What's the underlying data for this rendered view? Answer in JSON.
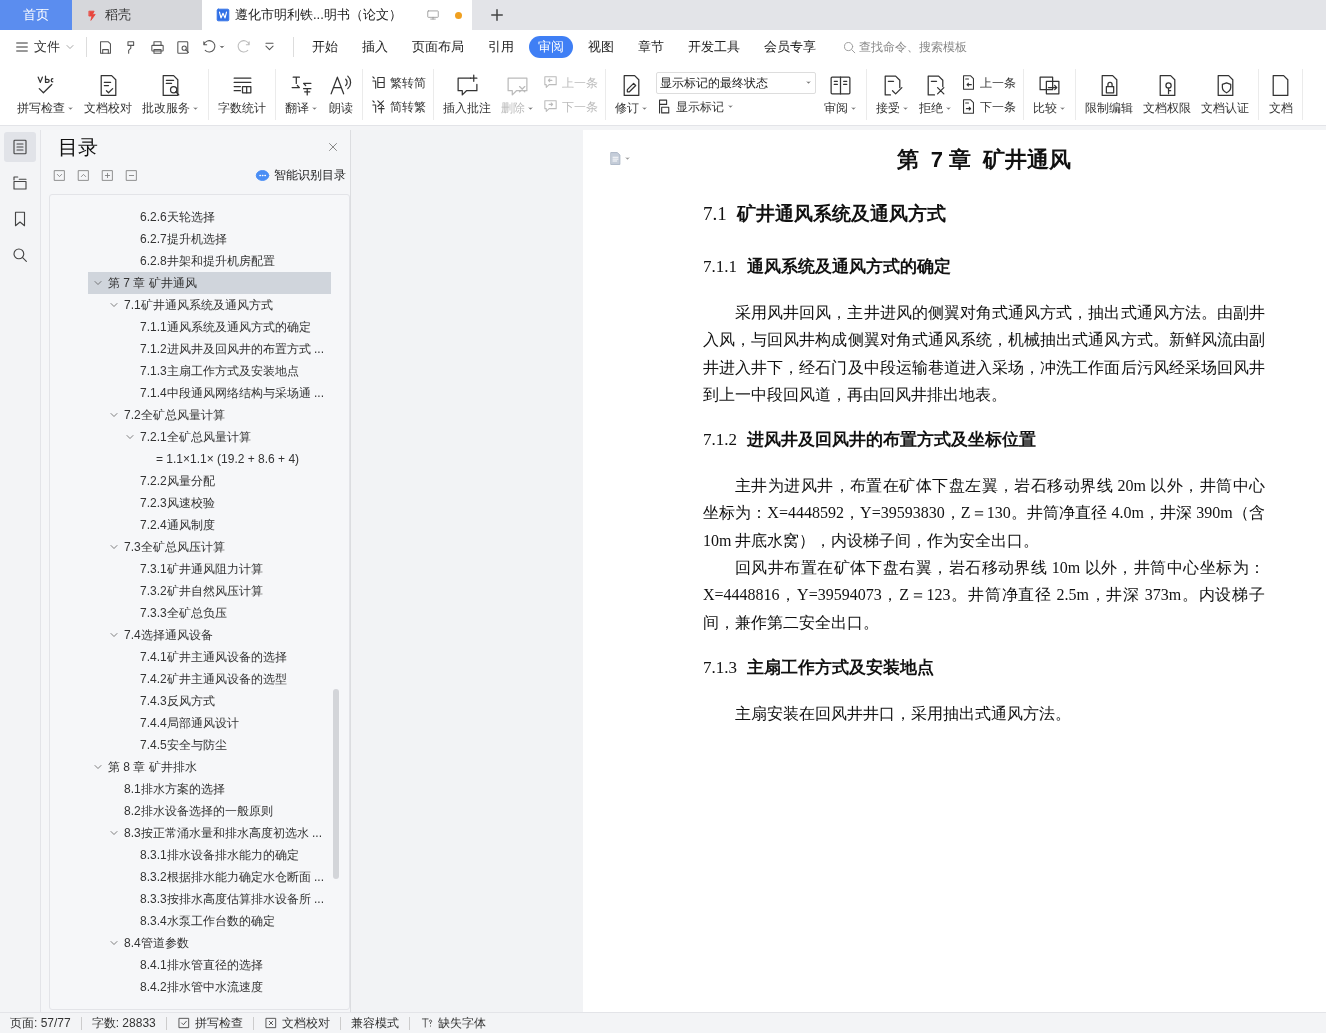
{
  "tab_bar": {
    "tabs": [
      {
        "label": "首页",
        "kind": "home",
        "selected": false
      },
      {
        "label": "稻壳",
        "kind": "app",
        "selected": false
      },
      {
        "label": "遵化市明利铁...明书（论文）",
        "kind": "doc",
        "selected": true,
        "unsaved": true
      }
    ]
  },
  "menu_bar": {
    "file": "文件",
    "tabs": [
      {
        "label": "开始",
        "selected": false
      },
      {
        "label": "插入",
        "selected": false
      },
      {
        "label": "页面布局",
        "selected": false
      },
      {
        "label": "引用",
        "selected": false
      },
      {
        "label": "审阅",
        "selected": true
      },
      {
        "label": "视图",
        "selected": false
      },
      {
        "label": "章节",
        "selected": false
      },
      {
        "label": "开发工具",
        "selected": false
      },
      {
        "label": "会员专享",
        "selected": false
      }
    ],
    "search": {
      "placeholder": "查找命令、搜索模板"
    }
  },
  "ribbon": {
    "groups": [
      {
        "items": [
          {
            "kind": "large",
            "label": "拼写检查",
            "dropdown": true,
            "disabled": false
          },
          {
            "kind": "large",
            "label": "文档校对",
            "dropdown": false,
            "disabled": false
          },
          {
            "kind": "large",
            "label": "批改服务",
            "dropdown": true,
            "disabled": false
          }
        ]
      },
      {
        "items": [
          {
            "kind": "large",
            "label": "字数统计",
            "dropdown": false,
            "disabled": false
          }
        ]
      },
      {
        "items": [
          {
            "kind": "large",
            "label": "翻译",
            "dropdown": true,
            "disabled": false
          },
          {
            "kind": "large",
            "label": "朗读",
            "dropdown": false,
            "disabled": false
          }
        ]
      },
      {
        "items": [
          {
            "kind": "stack",
            "items": [
              {
                "kind": "small",
                "label": "繁转简",
                "dropdown": false,
                "disabled": false
              },
              {
                "kind": "small",
                "label": "简转繁",
                "dropdown": false,
                "disabled": false
              }
            ]
          }
        ]
      },
      {
        "items": [
          {
            "kind": "large",
            "label": "插入批注",
            "dropdown": false,
            "disabled": false
          },
          {
            "kind": "large",
            "label": "删除",
            "dropdown": true,
            "disabled": true
          },
          {
            "kind": "stack",
            "items": [
              {
                "kind": "small",
                "label": "上一条",
                "dropdown": false,
                "disabled": true
              },
              {
                "kind": "small",
                "label": "下一条",
                "dropdown": false,
                "disabled": true
              }
            ]
          }
        ]
      },
      {
        "items": [
          {
            "kind": "large",
            "label": "修订",
            "dropdown": true,
            "disabled": false
          },
          {
            "kind": "stack",
            "items": [
              {
                "kind": "select",
                "value": "显示标记的最终状态"
              },
              {
                "kind": "small",
                "label": "显示标记",
                "dropdown": true,
                "disabled": false
              }
            ]
          },
          {
            "kind": "large",
            "label": "审阅",
            "dropdown": true,
            "disabled": false
          }
        ]
      },
      {
        "items": [
          {
            "kind": "large",
            "label": "接受",
            "dropdown": true,
            "disabled": false
          },
          {
            "kind": "large",
            "label": "拒绝",
            "dropdown": true,
            "disabled": false
          },
          {
            "kind": "stack",
            "items": [
              {
                "kind": "small",
                "label": "上一条",
                "dropdown": false,
                "disabled": false
              },
              {
                "kind": "small",
                "label": "下一条",
                "dropdown": false,
                "disabled": false
              }
            ]
          }
        ]
      },
      {
        "items": [
          {
            "kind": "large",
            "label": "比较",
            "dropdown": true,
            "disabled": false
          }
        ]
      },
      {
        "items": [
          {
            "kind": "large",
            "label": "限制编辑",
            "dropdown": false,
            "disabled": false
          },
          {
            "kind": "large",
            "label": "文档权限",
            "dropdown": false,
            "disabled": false
          },
          {
            "kind": "large",
            "label": "文档认证",
            "dropdown": false,
            "disabled": false
          }
        ]
      },
      {
        "items": [
          {
            "kind": "large",
            "label": "文档",
            "dropdown": false,
            "disabled": false
          }
        ]
      }
    ]
  },
  "side_rail": [
    {
      "selected": true
    },
    {
      "selected": false
    },
    {
      "selected": false
    },
    {
      "selected": false
    }
  ],
  "toc": {
    "title": "目录",
    "smart_detect": "智能识别目录",
    "items": [
      {
        "children": [
          {
            "children": [
              {
                "label": "6.2.6天轮选择",
                "selected": false
              },
              {
                "label": "6.2.7提升机选择",
                "selected": false
              },
              {
                "label": "6.2.8井架和提升机房配置",
                "selected": false
              }
            ]
          }
        ]
      },
      {
        "label": "第 7 章 矿井通风",
        "selected": true,
        "expanded": true,
        "children": [
          {
            "label": "7.1矿井通风系统及通风方式",
            "selected": false,
            "expanded": true,
            "children": [
              {
                "label": "7.1.1通风系统及通风方式的确定",
                "selected": false
              },
              {
                "label": "7.1.2进风井及回风井的布置方式 ...",
                "selected": false
              },
              {
                "label": "7.1.3主扇工作方式及安装地点",
                "selected": false
              },
              {
                "label": "7.1.4中段通风网络结构与采场通 ...",
                "selected": false
              }
            ]
          },
          {
            "label": "7.2全矿总风量计算",
            "selected": false,
            "expanded": true,
            "children": [
              {
                "label": "7.2.1全矿总风量计算",
                "selected": false,
                "expanded": true,
                "children": [
                  {
                    "label": "= 1.1×1.1× (19.2 + 8.6 + 4)",
                    "selected": false
                  }
                ]
              },
              {
                "label": "7.2.2风量分配",
                "selected": false
              },
              {
                "label": "7.2.3风速校验",
                "selected": false
              },
              {
                "label": "7.2.4通风制度",
                "selected": false
              }
            ]
          },
          {
            "label": "7.3全矿总风压计算",
            "selected": false,
            "expanded": true,
            "children": [
              {
                "label": "7.3.1矿井通风阻力计算",
                "selected": false
              },
              {
                "label": "7.3.2矿井自然风压计算",
                "selected": false
              },
              {
                "label": "7.3.3全矿总负压",
                "selected": false
              }
            ]
          },
          {
            "label": "7.4选择通风设备",
            "selected": false,
            "expanded": true,
            "children": [
              {
                "label": "7.4.1矿井主通风设备的选择",
                "selected": false
              },
              {
                "label": "7.4.2矿井主通风设备的选型",
                "selected": false
              },
              {
                "label": "7.4.3反风方式",
                "selected": false
              },
              {
                "label": "7.4.4局部通风设计",
                "selected": false
              },
              {
                "label": "7.4.5安全与防尘",
                "selected": false
              }
            ]
          }
        ]
      },
      {
        "label": "第 8 章 矿井排水",
        "selected": false,
        "expanded": true,
        "children": [
          {
            "label": "8.1排水方案的选择",
            "selected": false
          },
          {
            "label": "8.2排水设备选择的一般原则",
            "selected": false
          },
          {
            "label": "8.3按正常涌水量和排水高度初选水 ...",
            "selected": false,
            "expanded": true,
            "children": [
              {
                "label": "8.3.1排水设备排水能力的确定",
                "selected": false
              },
              {
                "label": "8.3.2根据排水能力确定水仓断面 ...",
                "selected": false
              },
              {
                "label": "8.3.3按排水高度估算排水设备所 ...",
                "selected": false
              },
              {
                "label": "8.3.4水泵工作台数的确定",
                "selected": false
              }
            ]
          },
          {
            "label": "8.4管道参数",
            "selected": false,
            "expanded": true,
            "children": [
              {
                "label": "8.4.1排水管直径的选择",
                "selected": false
              },
              {
                "label": "8.4.2排水管中水流速度",
                "selected": false
              }
            ]
          }
        ]
      }
    ]
  },
  "document": {
    "blocks": [
      {
        "kind": "chapter",
        "text": "第  7 章  矿井通风"
      },
      {
        "kind": "h2",
        "number": "7.1",
        "title": "矿井通风系统及通风方式"
      },
      {
        "kind": "h3",
        "number": "7.1.1",
        "title": "通风系统及通风方式的确定"
      },
      {
        "kind": "p",
        "text": "采用风井回风，主井进风的侧翼对角式通风方式，抽出式通风方法。由副井入风，与回风井构成侧翼对角式通风系统，机械抽出式通风方式。新鲜风流由副井进入井下，经石门及中段运输巷道进入采场，冲洗工作面后污风经采场回风井到上一中段回风道，再由回风井排出地表。"
      },
      {
        "kind": "h3",
        "number": "7.1.2",
        "title": "进风井及回风井的布置方式及坐标位置"
      },
      {
        "kind": "p",
        "text": "主井为进风井，布置在矿体下盘左翼，岩石移动界线 20m 以外，井筒中心坐标为：X=4448592，Y=39593830，Z＝130。井筒净直径 4.0m，井深 390m（含10m 井底水窝），内设梯子间，作为安全出口。"
      },
      {
        "kind": "p",
        "text": "回风井布置在矿体下盘右翼，岩石移动界线 10m 以外，井筒中心坐标为：X=4448816，Y=39594073，Z＝123。井筒净直径 2.5m，井深 373m。内设梯子间，兼作第二安全出口。"
      },
      {
        "kind": "h3",
        "number": "7.1.3",
        "title": "主扇工作方式及安装地点"
      },
      {
        "kind": "p",
        "text": "主扇安装在回风井井口，采用抽出式通风方法。"
      }
    ]
  },
  "status_bar": [
    {
      "kind": "text",
      "label": "页面: 57/77"
    },
    {
      "kind": "text",
      "label": "字数: 28833"
    },
    {
      "kind": "button",
      "label": "拼写检查"
    },
    {
      "kind": "button",
      "label": "文档校对"
    },
    {
      "kind": "text",
      "label": "兼容模式"
    },
    {
      "kind": "button",
      "label": "缺失字体"
    }
  ]
}
